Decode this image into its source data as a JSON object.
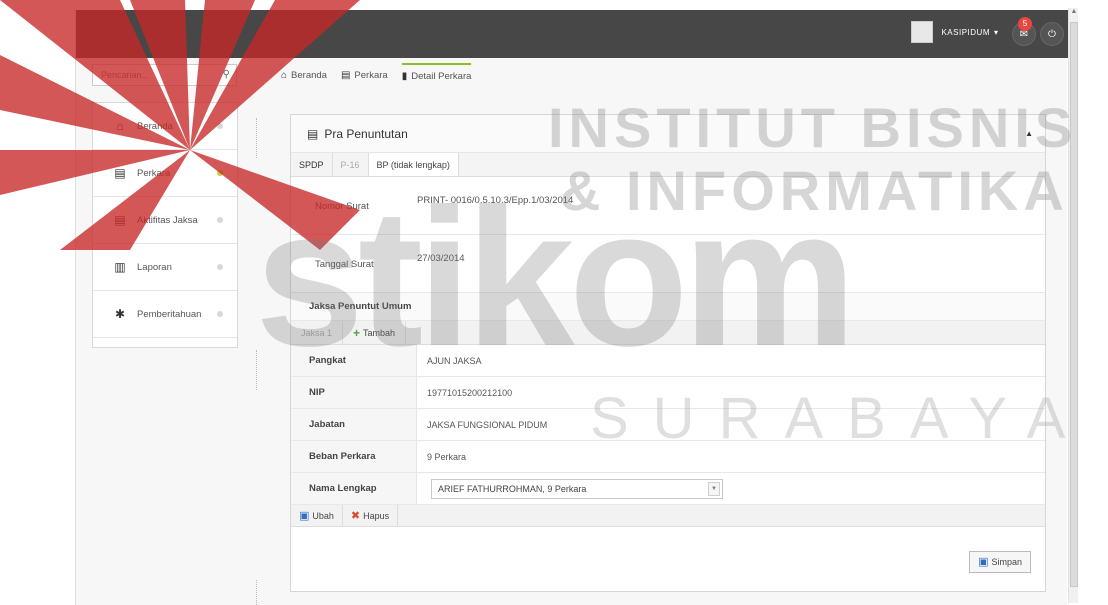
{
  "topbar": {
    "user_name": "KASIPIDUM",
    "user_caret": "▾",
    "notif_count": "5",
    "msg_icon": "envelope-icon",
    "power_icon": "power-icon"
  },
  "search": {
    "placeholder": "Pencarian..."
  },
  "breadcrumb": {
    "items": [
      "Beranda",
      "Perkara",
      "Detail Perkara"
    ]
  },
  "sidebar": {
    "items": [
      {
        "label": "Beranda",
        "icon": "home-icon"
      },
      {
        "label": "Perkara",
        "icon": "clipboard-icon"
      },
      {
        "label": "Aktifitas Jaksa",
        "icon": "clipboard-icon"
      },
      {
        "label": "Laporan",
        "icon": "bar-chart-icon"
      },
      {
        "label": "Pemberitahuan",
        "icon": "megaphone-icon"
      }
    ]
  },
  "panel": {
    "title": "Pra Penuntutan",
    "tabs": [
      "SPDP",
      "P-16",
      "BP (tidak lengkap)"
    ],
    "nomor_surat_label": "Nomor Surat",
    "nomor_surat_value": "PRINT- 0016/0.5.10.3/Epp.1/03/2014",
    "tanggal_surat_label": "Tanggal Surat",
    "tanggal_surat_value": "27/03/2014",
    "jpu_title": "Jaksa Penuntut Umum",
    "subtabs": {
      "jaksa": "Jaksa 1",
      "add": "Tambah"
    },
    "details": [
      {
        "label": "Pangkat",
        "value": "AJUN JAKSA"
      },
      {
        "label": "NIP",
        "value": "19771015200212100"
      },
      {
        "label": "Jabatan",
        "value": "JAKSA FUNGSIONAL PIDUM"
      },
      {
        "label": "Beban Perkara",
        "value": "9 Perkara"
      }
    ],
    "nama_lengkap_label": "Nama Lengkap",
    "nama_lengkap_value": "ARIEF FATHURROHMAN, 9 Perkara",
    "actions": {
      "edit": "Ubah",
      "delete": "Hapus"
    },
    "save": "Simpan"
  },
  "colors": {
    "topbar": "#474747",
    "accent_green": "#8cbf26",
    "badge_red": "#e8463f",
    "watermark_red": "#c0392b"
  }
}
